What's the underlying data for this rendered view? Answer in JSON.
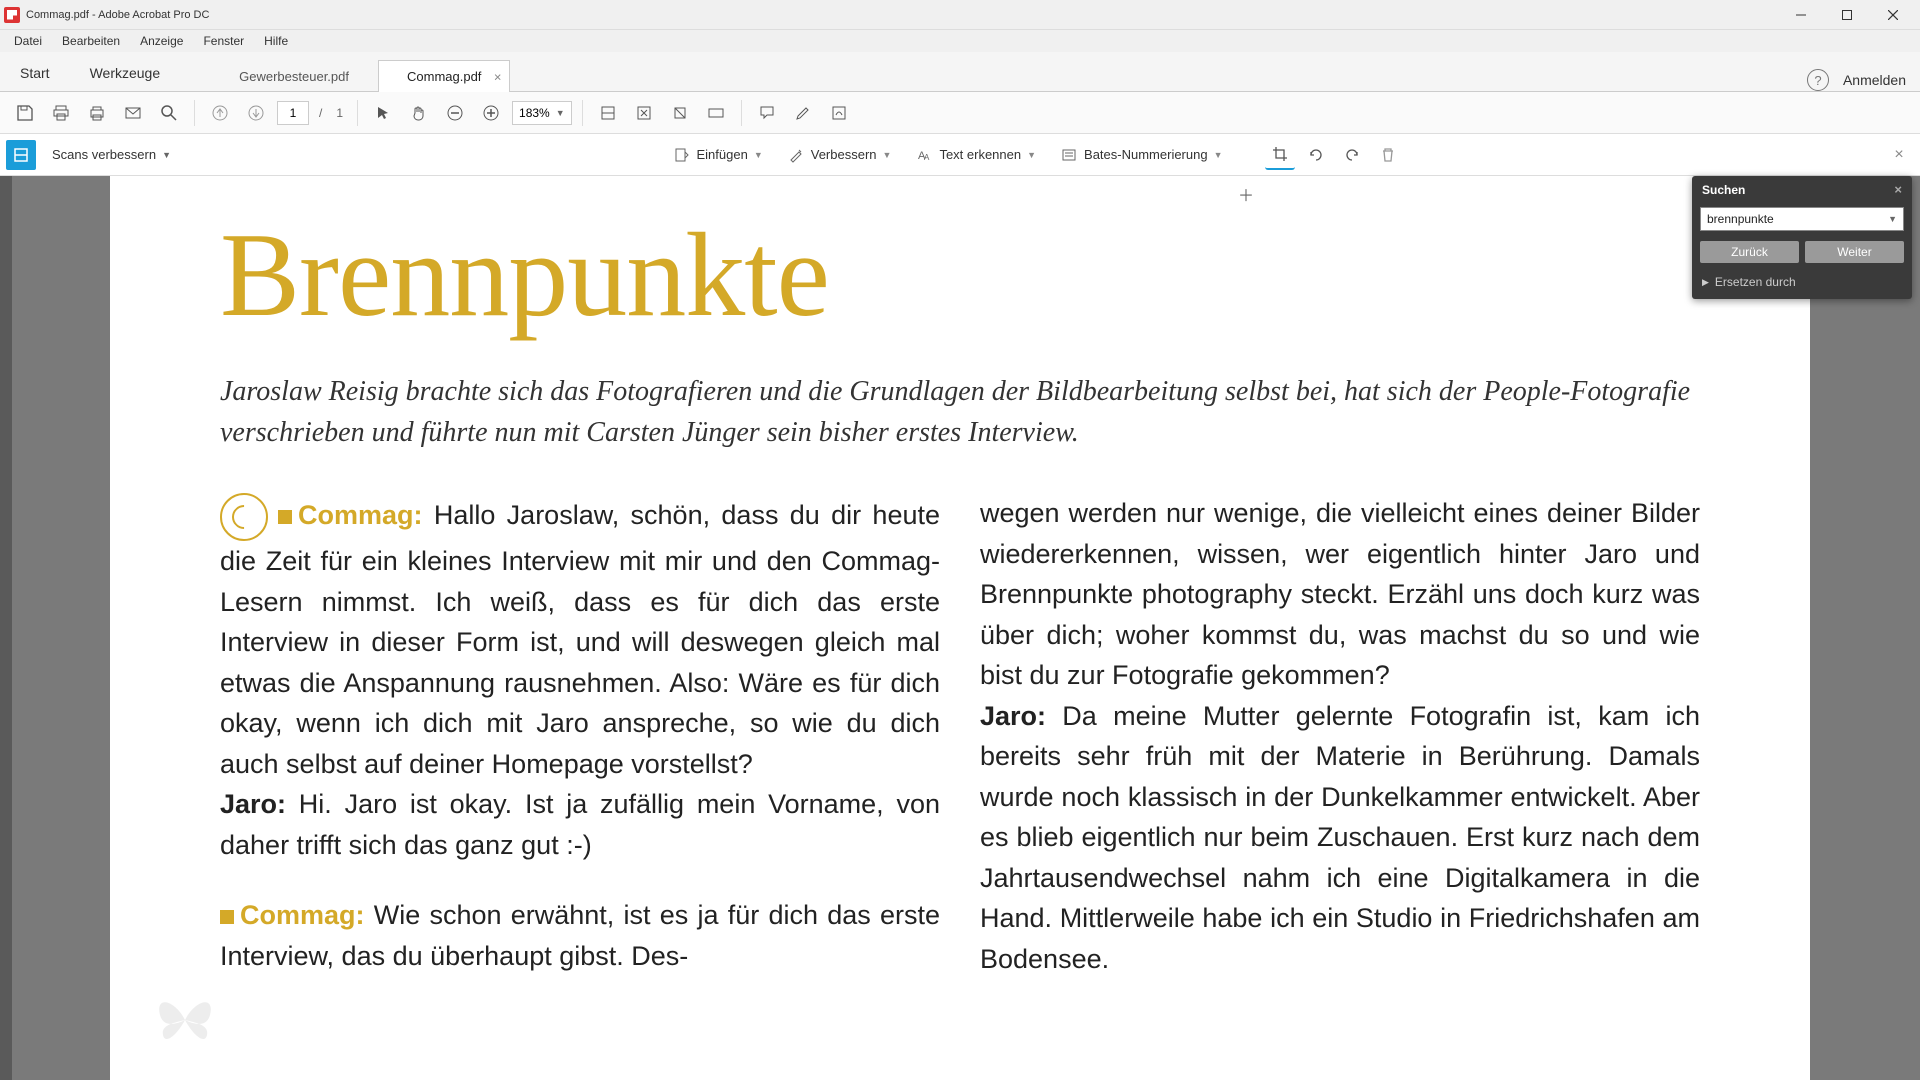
{
  "title": "Commag.pdf - Adobe Acrobat Pro DC",
  "menu": {
    "file": "Datei",
    "edit": "Bearbeiten",
    "view": "Anzeige",
    "window": "Fenster",
    "help": "Hilfe"
  },
  "maintabs": {
    "start": "Start",
    "tools": "Werkzeuge"
  },
  "doctabs": [
    {
      "label": "Gewerbesteuer.pdf",
      "active": false
    },
    {
      "label": "Commag.pdf",
      "active": true
    }
  ],
  "signin": "Anmelden",
  "page": {
    "current": "1",
    "sep": "/",
    "total": "1"
  },
  "zoom": "183%",
  "subbar": {
    "scans": "Scans verbessern",
    "insert": "Einfügen",
    "enhance": "Verbessern",
    "ocr": "Text erkennen",
    "bates": "Bates-Nummerierung"
  },
  "search": {
    "title": "Suchen",
    "value": "brennpunkte",
    "back": "Zurück",
    "next": "Weiter",
    "replace": "Ersetzen durch"
  },
  "doc": {
    "heading": "Brennpunkte",
    "lead": "Jaroslaw Reisig brachte sich das Fotografieren und die Grundlagen der Bildbearbeitung selbst bei, hat sich der People-Fotografie verschrieben und führte nun mit Carsten Jünger sein bisher erstes Interview.",
    "col1": {
      "p1_tag": "Commag:",
      "p1": " Hallo Jaroslaw, schön, dass du dir heute die Zeit für ein kleines Interview mit mir und den Commag-Lesern nimmst. Ich weiß, dass es für dich das erste Interview in dieser Form ist, und will deswegen gleich mal etwas die An­spannung rausnehmen. Also: Wäre es für dich okay, wenn ich dich mit Jaro anspreche, so wie du dich auch selbst auf deiner Homepage vorstellst?",
      "p2_tag": "Jaro:",
      "p2": " Hi. Jaro ist okay. Ist ja zufällig mein Vorname, von daher trifft sich das ganz gut :-)",
      "p3_tag": "Commag:",
      "p3": " Wie schon erwähnt, ist es ja für dich das erste Interview, das du überhaupt gibst. Des-"
    },
    "col2": {
      "p1": "wegen werden nur wenige, die vielleicht eines dei­ner Bilder wiedererkennen, wissen, wer eigentlich hinter Jaro und Brennpunkte photography steckt. Erzähl uns doch kurz was über dich; woher kommst du, was machst du so und wie bist du zur Fotografie gekommen?",
      "p2_tag": "Jaro:",
      "p2": " Da meine Mutter gelernte Fotografin ist, kam ich bereits sehr früh mit der Materie in Berührung. Da­mals wurde noch klassisch in der Dunkelkammer ent­wickelt. Aber es blieb eigentlich nur beim Zuschauen. Erst kurz nach dem Jahrtausendwechsel nahm ich eine Digitalkamera in die Hand. Mittlerweile habe ich ein Studio in Friedrichshafen am Bodensee."
    }
  }
}
